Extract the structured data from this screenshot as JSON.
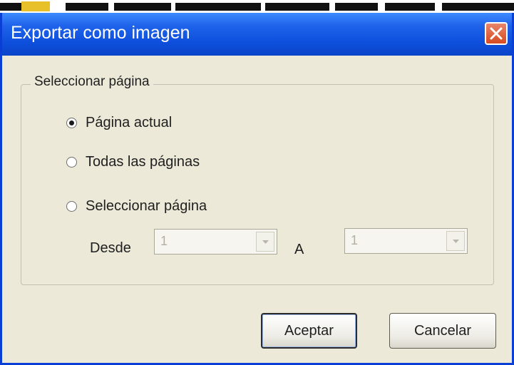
{
  "dialog": {
    "title": "Exportar como imagen",
    "group_label": "Seleccionar página",
    "radios": [
      {
        "label": "Página actual",
        "checked": true
      },
      {
        "label": "Todas las páginas",
        "checked": false
      },
      {
        "label": "Seleccionar página",
        "checked": false
      }
    ],
    "range": {
      "from_label": "Desde",
      "from_value": "1",
      "to_label": "A",
      "to_value": "1"
    },
    "buttons": {
      "ok": "Aceptar",
      "cancel": "Cancelar"
    }
  },
  "icons": {
    "close": "close-icon",
    "dropdown": "chevron-down-icon"
  },
  "colors": {
    "titlebar": "#0d4fdc",
    "window_bg": "#ece9d8",
    "close_button": "#d64a20"
  }
}
